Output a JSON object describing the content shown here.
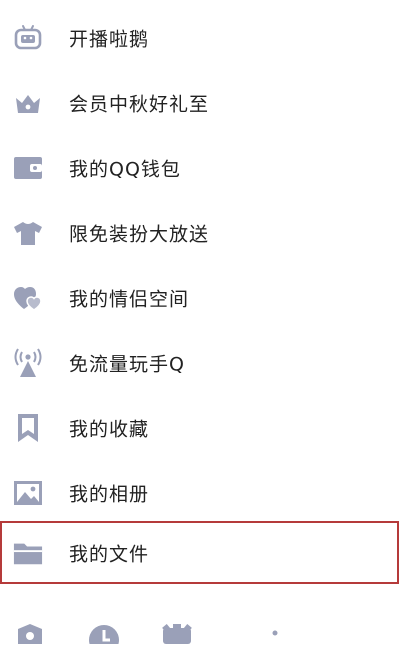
{
  "menu": {
    "items": [
      {
        "label": "开播啦鹅",
        "icon": "tv-robot-icon"
      },
      {
        "label": "会员中秋好礼至",
        "icon": "crown-icon"
      },
      {
        "label": "我的QQ钱包",
        "icon": "wallet-icon"
      },
      {
        "label": "限免装扮大放送",
        "icon": "tshirt-icon"
      },
      {
        "label": "我的情侣空间",
        "icon": "couple-hearts-icon"
      },
      {
        "label": "免流量玩手Q",
        "icon": "signal-tower-icon"
      },
      {
        "label": "我的收藏",
        "icon": "bookmark-icon"
      },
      {
        "label": "我的相册",
        "icon": "photo-album-icon"
      },
      {
        "label": "我的文件",
        "icon": "folder-icon"
      }
    ]
  },
  "colors": {
    "icon": "#9aa0b8",
    "text": "#222222",
    "highlight_border": "#b53a3a"
  },
  "bottom_bar": {
    "icons": [
      "shield-icon",
      "clock-icon",
      "gear-icon",
      "moon-icon"
    ]
  }
}
